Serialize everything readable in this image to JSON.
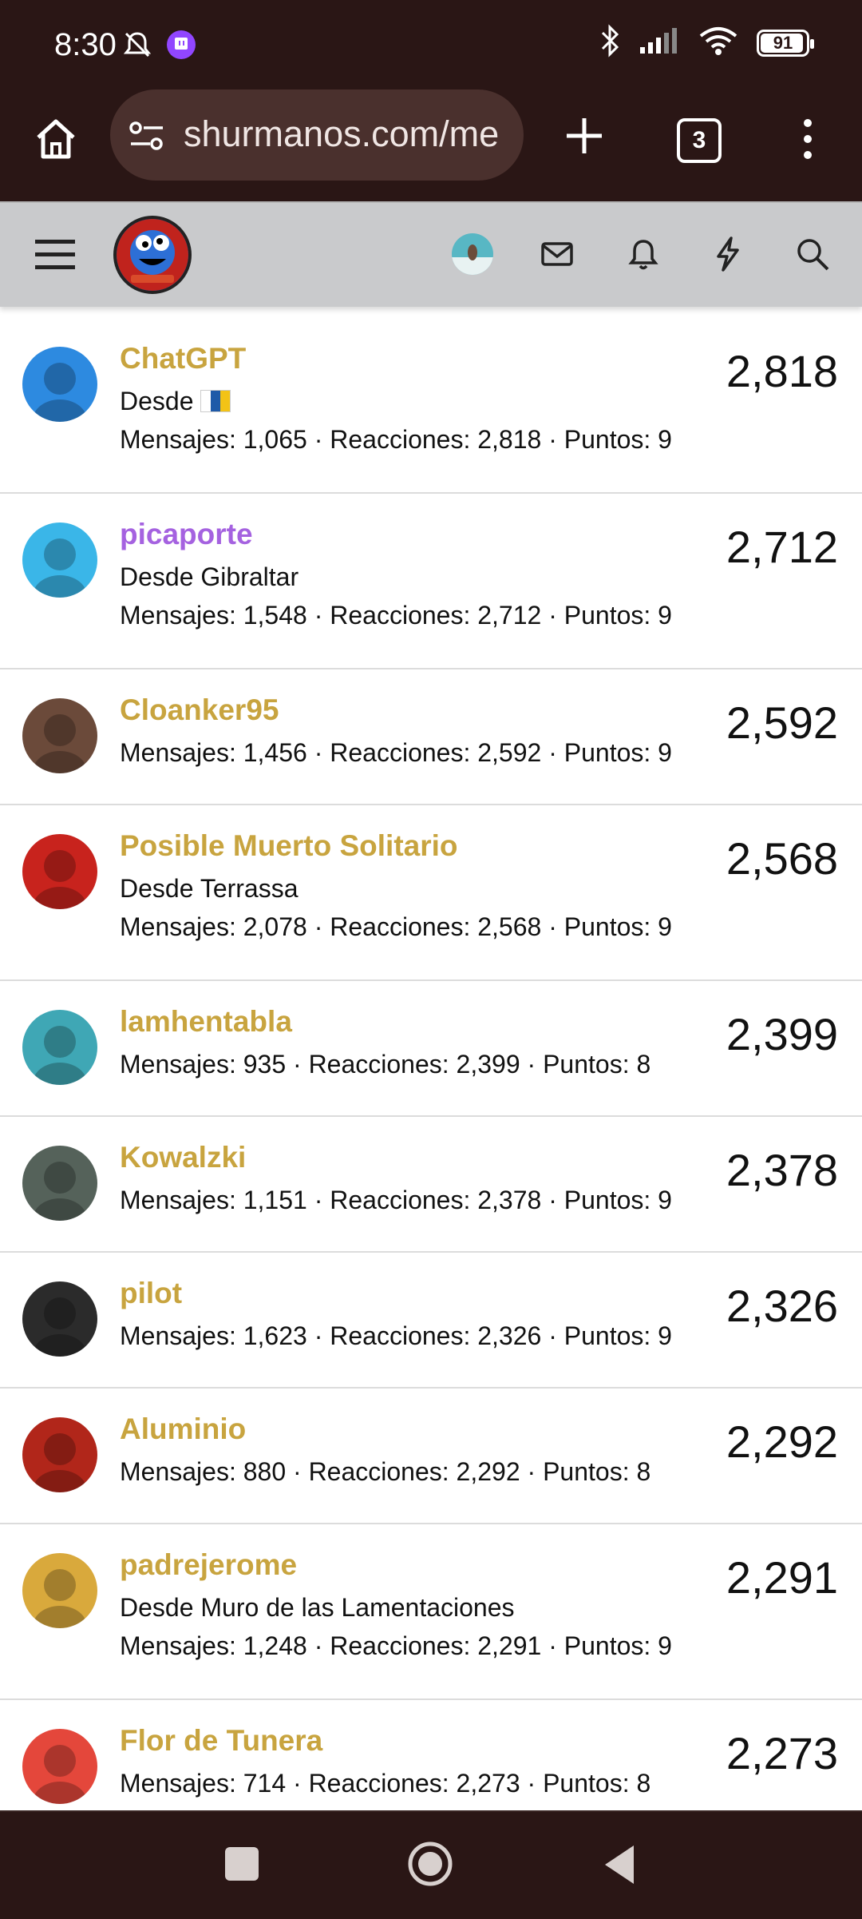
{
  "status_bar": {
    "time": "8:30",
    "battery": "91",
    "icons": [
      "mute-bell-icon",
      "twitch-icon",
      "bluetooth-icon",
      "signal-icon",
      "wifi-icon",
      "battery-icon"
    ]
  },
  "browser": {
    "url": "shurmanos.com/me",
    "tab_count": "3",
    "icons": [
      "home-icon",
      "site-settings-icon",
      "new-tab-icon",
      "tab-switcher-icon",
      "overflow-menu-icon"
    ]
  },
  "site_header": {
    "icons": [
      "hamburger-icon",
      "site-logo",
      "user-avatar",
      "mail-icon",
      "bell-icon",
      "lightning-icon",
      "search-icon"
    ]
  },
  "colors": {
    "brand_dark": "#2a1615",
    "name_gold": "#c8a43f",
    "name_purple": "#a562e0",
    "header_gray": "#c9cacc"
  },
  "members": [
    {
      "name": "ChatGPT",
      "location": "Desde",
      "flag": true,
      "stats": "Mensajes: 1,065 · Reacciones: 2,818 · Puntos: 9",
      "score": "2,818",
      "color": "gold",
      "avatar_color": "#2d8ae0"
    },
    {
      "name": "picaporte",
      "location": "Desde Gibraltar",
      "flag": false,
      "stats": "Mensajes: 1,548 · Reacciones: 2,712 · Puntos: 9",
      "score": "2,712",
      "color": "purple",
      "avatar_color": "#3ab6e8"
    },
    {
      "name": "Cloanker95",
      "location": "",
      "flag": false,
      "stats": "Mensajes: 1,456 · Reacciones: 2,592 · Puntos: 9",
      "score": "2,592",
      "color": "gold",
      "avatar_color": "#6b4a3a"
    },
    {
      "name": "Posible Muerto Solitario",
      "location": "Desde Terrassa",
      "flag": false,
      "stats": "Mensajes: 2,078 · Reacciones: 2,568 · Puntos: 9",
      "score": "2,568",
      "color": "gold",
      "avatar_color": "#c8231d"
    },
    {
      "name": "lamhentabla",
      "location": "",
      "flag": false,
      "stats": "Mensajes: 935 · Reacciones: 2,399 · Puntos: 8",
      "score": "2,399",
      "color": "gold",
      "avatar_color": "#3fa7b5"
    },
    {
      "name": "Kowalzki",
      "location": "",
      "flag": false,
      "stats": "Mensajes: 1,151 · Reacciones: 2,378 · Puntos: 9",
      "score": "2,378",
      "color": "gold",
      "avatar_color": "#55625a"
    },
    {
      "name": "pilot",
      "location": "",
      "flag": false,
      "stats": "Mensajes: 1,623 · Reacciones: 2,326 · Puntos: 9",
      "score": "2,326",
      "color": "gold",
      "avatar_color": "#2b2b2b"
    },
    {
      "name": "Aluminio",
      "location": "",
      "flag": false,
      "stats": "Mensajes: 880 · Reacciones: 2,292 · Puntos: 8",
      "score": "2,292",
      "color": "gold",
      "avatar_color": "#b1261a"
    },
    {
      "name": "padrejerome",
      "location": "Desde Muro de las Lamentaciones",
      "flag": false,
      "stats": "Mensajes: 1,248 · Reacciones: 2,291 · Puntos: 9",
      "score": "2,291",
      "color": "gold",
      "avatar_color": "#d9a93c"
    },
    {
      "name": "Flor de Tunera",
      "location": "",
      "flag": false,
      "stats": "Mensajes: 714 · Reacciones: 2,273 · Puntos: 8",
      "score": "2,273",
      "color": "gold",
      "avatar_color": "#e4473b"
    }
  ],
  "nav_bar": {
    "icons": [
      "recents-icon",
      "home-circle-icon",
      "back-icon"
    ]
  }
}
